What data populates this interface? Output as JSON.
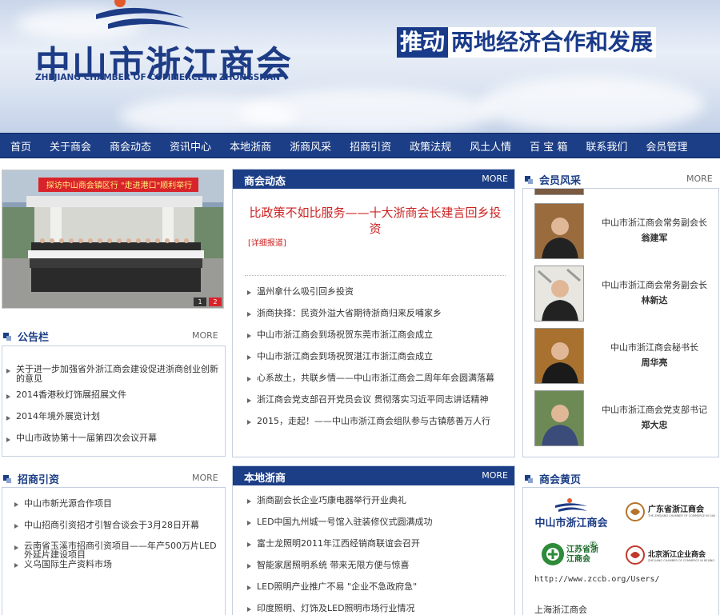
{
  "header": {
    "logo_cn": "中山市浙江商会",
    "logo_en": "ZHEJIANG CHAMBER OF COMMERCE IN ZHONGSHAN",
    "slogan_highlight": "推动",
    "slogan_rest": "两地经济合作和发展"
  },
  "nav": [
    "首页",
    "关于商会",
    "商会动态",
    "资讯中心",
    "本地浙商",
    "浙商风采",
    "招商引资",
    "政策法规",
    "风土人情",
    "百 宝 箱",
    "联系我们",
    "会员管理"
  ],
  "photo": {
    "banner_text": "探访中山商会镇区行    \"走进港口\"顺利举行",
    "pages": [
      "1",
      "2"
    ]
  },
  "notice": {
    "title": "公告栏",
    "more": "MORE",
    "items": [
      "关于进一步加强省外浙江商会建设促进浙商创业创新的意见",
      "2014香港秋灯饰展招展文件",
      "2014年境外展览计划",
      "中山市政协第十一届第四次会议开幕"
    ]
  },
  "news": {
    "title": "商会动态",
    "more": "MORE",
    "headline": "比政策不如比服务——十大浙商会长建言回乡投资",
    "detail_link": "[详细报道]",
    "items": [
      "温州拿什么吸引回乡投资",
      "浙商抉择：民资外溢大省期待浙商归来反哺家乡",
      "中山市浙江商会到场祝贺东莞市浙江商会成立",
      "中山市浙江商会到场祝贺湛江市浙江商会成立",
      "心系故土，共联乡情——中山市浙江商会二周年年会圆满落幕",
      "浙江商会党支部召开党员会议 贯彻落实习近平同志讲话精神",
      "2015，走起！——中山市浙江商会组队参与古镇慈善万人行"
    ]
  },
  "members": {
    "title": "会员风采",
    "more": "MORE",
    "items": [
      {
        "title": "中山市浙江商会常务副会长",
        "name": "翁建军"
      },
      {
        "title": "中山市浙江商会常务副会长",
        "name": "林新达"
      },
      {
        "title": "中山市浙江商会秘书长",
        "name": "周华亮"
      },
      {
        "title": "中山市浙江商会党支部书记",
        "name": "郑大忠"
      }
    ]
  },
  "invest": {
    "title": "招商引资",
    "more": "MORE",
    "items": [
      "中山市新光源合作项目",
      "中山招商引资招才引智合谈会于3月28日开幕",
      "云南省玉溪市招商引资项目——年产500万片LED外延片建设项目",
      "义乌国际生产资料市场"
    ]
  },
  "local": {
    "title": "本地浙商",
    "more": "MORE",
    "items": [
      "浙商副会长企业巧康电器举行开业典礼",
      "LED中国九州城一号馆入驻装修仪式圆满成功",
      "富士龙照明2011年江西经销商联谊会召开",
      "智能家居照明系统  带来无限方便与惊喜",
      "LED照明产业推广不易 \"企业不急政府急\"",
      "印度照明、灯饰及LED照明市场行业情况"
    ]
  },
  "yellow": {
    "title": "商会黄页",
    "logos": [
      {
        "cn": "中山市浙江商会"
      },
      {
        "cn": "广东省浙江商会",
        "en": "THE ZHEJIANG CHAMBER OF COMMERCE IN GUANGDONG"
      },
      {
        "cn": "江苏省浙江商会"
      },
      {
        "cn": "北京浙江企业商会",
        "en": "ZHE JIANG CHAMBER OF COMMERCE IN BEIJING"
      }
    ],
    "link_url": "http://www.zccb.org/Users/",
    "link_text": "上海浙江商会"
  },
  "colors": {
    "nav_bg": "#1c3e86",
    "headline_red": "#cc2222",
    "border": "#c4cfe0"
  }
}
